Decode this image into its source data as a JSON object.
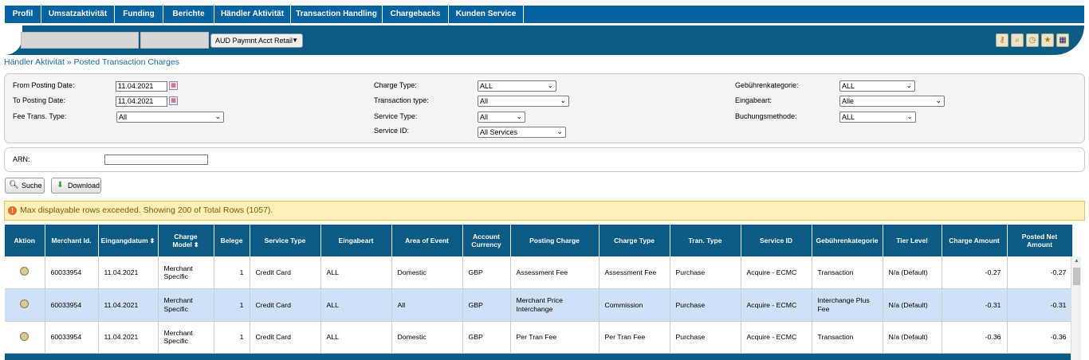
{
  "nav": {
    "tabs": [
      "Profil",
      "Umsatzaktivität",
      "Funding",
      "Berichte",
      "Händler Aktivität",
      "Transaction Handling",
      "Chargebacks",
      "Kunden Service"
    ]
  },
  "subbar": {
    "account_select": "AUD Paymnt Acct Retail",
    "icons": [
      "key-icon",
      "magnifier-icon",
      "clock-icon",
      "star-icon",
      "qr-code-icon"
    ]
  },
  "breadcrumb": "Händler Aktivität » Posted Transaction Charges",
  "filters": {
    "from_posting_date_label": "From Posting Date:",
    "from_posting_date": "11.04.2021",
    "to_posting_date_label": "To Posting Date:",
    "to_posting_date": "11.04.2021",
    "fee_trans_type_label": "Fee Trans. Type:",
    "fee_trans_type": "All",
    "charge_type_label": "Charge Type:",
    "charge_type": "ALL",
    "transaction_type_label": "Transaction type:",
    "transaction_type": "All",
    "service_type_label": "Service Type:",
    "service_type": "All",
    "service_id_label": "Service ID:",
    "service_id": "All Services",
    "gebuehrenkategorie_label": "Gebührenkategorie:",
    "gebuehrenkategorie": "ALL",
    "eingabeart_label": "Eingabeart:",
    "eingabeart": "Alle",
    "buchungsmethode_label": "Buchungsmethode:",
    "buchungsmethode": "ALL",
    "arn_label": "ARN:",
    "arn": ""
  },
  "buttons": {
    "search": "Suche",
    "download": "Download"
  },
  "warning": "Max displayable rows exceeded. Showing 200 of Total Rows (1057).",
  "table": {
    "headers": [
      "Aktion",
      "Merchant Id.",
      "Eingangdatum",
      "Charge Model",
      "Belege",
      "Service Type",
      "Eingabeart",
      "Area of Event",
      "Account Currency",
      "Posting Charge",
      "Charge Type",
      "Tran. Type",
      "Service ID",
      "Gebührenkategorie",
      "Tier Level",
      "Charge Amount",
      "Posted Net Amount"
    ],
    "rows": [
      [
        "",
        "60033954",
        "11.04.2021",
        "Merchant Specific",
        "1",
        "Credit Card",
        "ALL",
        "Domestic",
        "GBP",
        "Assessment Fee",
        "Assessment Fee",
        "Purchase",
        "Acquire - ECMC",
        "Transaction",
        "N/a (Default)",
        "-0.27",
        "-0.27"
      ],
      [
        "",
        "60033954",
        "11.04.2021",
        "Merchant Specific",
        "1",
        "Credit Card",
        "ALL",
        "All",
        "GBP",
        "Merchant Price Interchange",
        "Commission",
        "Purchase",
        "Acquire - ECMC",
        "Interchange Plus Fee",
        "N/a (Default)",
        "-0.31",
        "-0.31"
      ],
      [
        "",
        "60033954",
        "11.04.2021",
        "Merchant Specific",
        "1",
        "Credit Card",
        "ALL",
        "Domestic",
        "GBP",
        "Per Tran Fee",
        "Per Tran Fee",
        "Purchase",
        "Acquire - ECMC",
        "Transaction",
        "N/a (Default)",
        "-0.36",
        "-0.36"
      ]
    ]
  },
  "colors": {
    "nav_blue": "#05649f",
    "header_blue": "#0b5b85",
    "row_alt": "#cfe1f7",
    "warning_bg": "#fcefb8"
  }
}
